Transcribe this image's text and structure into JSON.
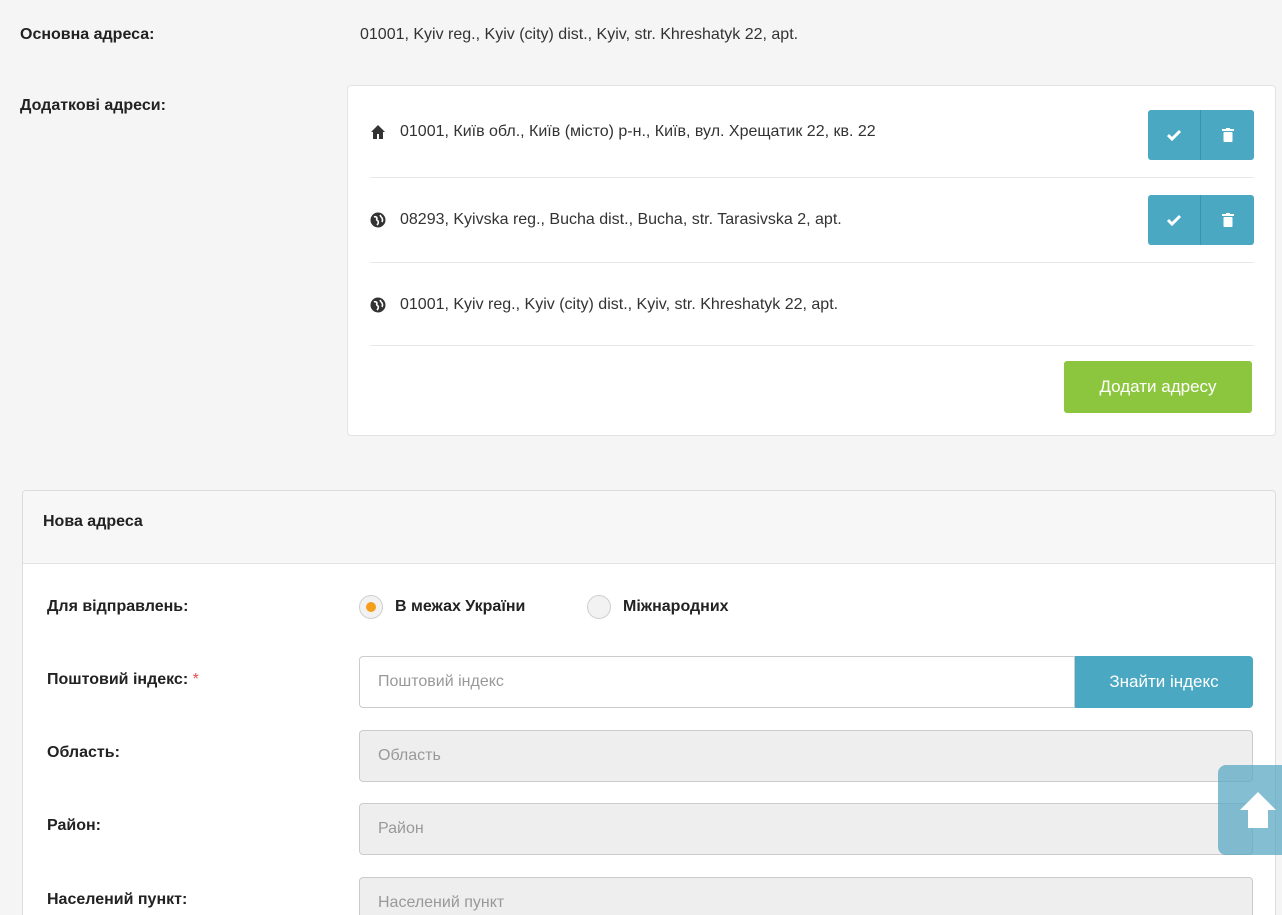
{
  "main_address": {
    "label": "Основна адреса:",
    "value": "01001, Kyiv reg., Kyiv (city) dist., Kyiv, str. Khreshatyk 22, apt."
  },
  "extra_addresses": {
    "label": "Додаткові адреси:",
    "items": [
      {
        "icon": "home-icon",
        "text": "01001, Київ обл., Київ (місто) р-н., Київ, вул. Хрещатик 22, кв. 22"
      },
      {
        "icon": "globe-icon",
        "text": "08293, Kyivska reg., Bucha dist., Bucha, str. Tarasivska 2, apt."
      },
      {
        "icon": "globe-icon",
        "text": "01001, Kyiv reg., Kyiv (city) dist., Kyiv, str. Khreshatyk 22, apt."
      }
    ],
    "add_button": "Додати адресу"
  },
  "new_address": {
    "title": "Нова адреса",
    "shipments": {
      "label": "Для відправлень:",
      "options": [
        "В межах України",
        "Міжнародних"
      ],
      "selected": "В межах України"
    },
    "postal_code": {
      "label": "Поштовий індекс:",
      "required_mark": "*",
      "placeholder": "Поштовий індекс",
      "button": "Знайти індекс"
    },
    "region": {
      "label": "Область:",
      "placeholder": "Область"
    },
    "district": {
      "label": "Район:",
      "placeholder": "Район"
    },
    "locality": {
      "label": "Населений пункт:",
      "placeholder": "Населений пункт"
    }
  },
  "colors": {
    "accent": "#4aa8c3",
    "add_button": "#8cc63e",
    "radio_selected": "#f59e1a",
    "required": "#d9534f"
  }
}
